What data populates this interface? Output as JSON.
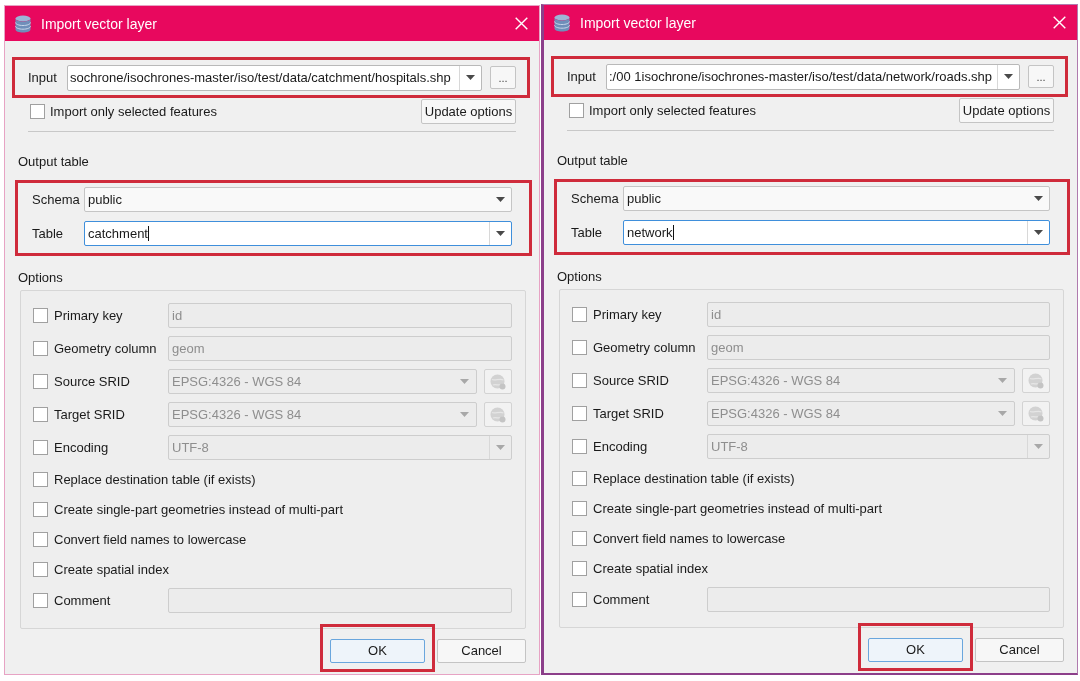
{
  "dialogs": [
    {
      "title": "Import vector layer",
      "input": {
        "label": "Input",
        "value": "sochrone/isochrones-master/iso/test/data/catchment/hospitals.shp",
        "highlighted": true
      },
      "browse_button": "...",
      "import_selected": {
        "label": "Import only selected features",
        "checked": false
      },
      "update_button": "Update options",
      "output_table": {
        "heading": "Output table",
        "highlighted": true,
        "fields": [
          {
            "label": "Schema",
            "value": "public",
            "focused": false
          },
          {
            "label": "Table",
            "value": "catchment",
            "focused": true
          }
        ]
      },
      "options": {
        "heading": "Options",
        "rows": [
          {
            "kind": "text",
            "label": "Primary key",
            "checked": false,
            "value": "id"
          },
          {
            "kind": "text",
            "label": "Geometry column",
            "checked": false,
            "value": "geom"
          },
          {
            "kind": "srid",
            "label": "Source SRID",
            "checked": false,
            "value": "EPSG:4326 - WGS 84"
          },
          {
            "kind": "srid",
            "label": "Target SRID",
            "checked": false,
            "value": "EPSG:4326 - WGS 84"
          },
          {
            "kind": "combo",
            "label": "Encoding",
            "checked": false,
            "value": "UTF-8"
          },
          {
            "kind": "check",
            "label": "Replace destination table (if exists)",
            "checked": false
          },
          {
            "kind": "check",
            "label": "Create single-part geometries instead of multi-part",
            "checked": false
          },
          {
            "kind": "check",
            "label": "Convert field names to lowercase",
            "checked": false
          },
          {
            "kind": "check",
            "label": "Create spatial index",
            "checked": false
          },
          {
            "kind": "text",
            "label": "Comment",
            "checked": false
          }
        ]
      },
      "buttons": [
        {
          "label": "OK",
          "default": true,
          "highlighted": true
        },
        {
          "label": "Cancel",
          "default": false,
          "highlighted": false
        }
      ]
    },
    {
      "title": "Import vector layer",
      "input": {
        "label": "Input",
        "value": ":/00 1isochrone/isochrones-master/iso/test/data/network/roads.shp",
        "highlighted": true
      },
      "browse_button": "...",
      "import_selected": {
        "label": "Import only selected features",
        "checked": false
      },
      "update_button": "Update options",
      "output_table": {
        "heading": "Output table",
        "highlighted": true,
        "fields": [
          {
            "label": "Schema",
            "value": "public",
            "focused": false
          },
          {
            "label": "Table",
            "value": "network",
            "focused": true
          }
        ]
      },
      "options": {
        "heading": "Options",
        "rows": [
          {
            "kind": "text",
            "label": "Primary key",
            "checked": false,
            "value": "id"
          },
          {
            "kind": "text",
            "label": "Geometry column",
            "checked": false,
            "value": "geom"
          },
          {
            "kind": "srid",
            "label": "Source SRID",
            "checked": false,
            "value": "EPSG:4326 - WGS 84"
          },
          {
            "kind": "srid",
            "label": "Target SRID",
            "checked": false,
            "value": "EPSG:4326 - WGS 84"
          },
          {
            "kind": "combo",
            "label": "Encoding",
            "checked": false,
            "value": "UTF-8"
          },
          {
            "kind": "check",
            "label": "Replace destination table (if exists)",
            "checked": false
          },
          {
            "kind": "check",
            "label": "Create single-part geometries instead of multi-part",
            "checked": false
          },
          {
            "kind": "check",
            "label": "Convert field names to lowercase",
            "checked": false
          },
          {
            "kind": "check",
            "label": "Create spatial index",
            "checked": false
          },
          {
            "kind": "text",
            "label": "Comment",
            "checked": false
          }
        ]
      },
      "buttons": [
        {
          "label": "OK",
          "default": true,
          "highlighted": true
        },
        {
          "label": "Cancel",
          "default": false,
          "highlighted": false
        }
      ]
    }
  ]
}
